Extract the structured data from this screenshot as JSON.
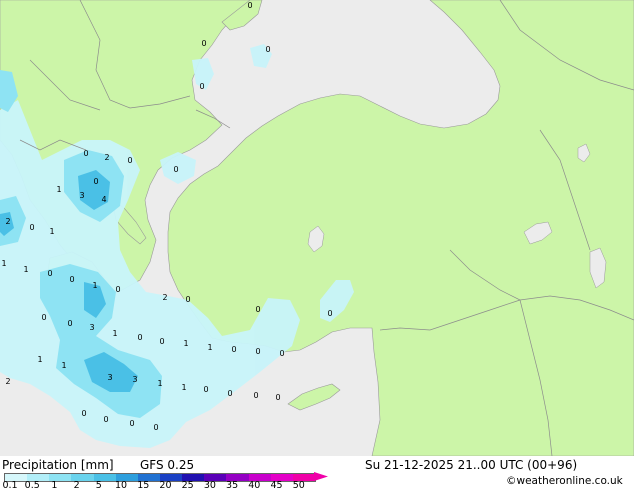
{
  "footer": {
    "title": "Precipitation [mm]",
    "model": "GFS 0.25",
    "datetime": "Su 21-12-2025 21..00 UTC (00+96)",
    "credit": "©weatheronline.co.uk"
  },
  "legend": {
    "ticks": [
      "0.1",
      "0.5",
      "1",
      "2",
      "5",
      "10",
      "15",
      "20",
      "25",
      "30",
      "35",
      "40",
      "45",
      "50"
    ],
    "colors": [
      "#d6f7fb",
      "#b2eef8",
      "#8ee3f3",
      "#6ad3ed",
      "#4ac0e6",
      "#2e9fdd",
      "#2171d1",
      "#1a40c4",
      "#2010b0",
      "#5a00b8",
      "#9400c4",
      "#c800cc",
      "#e400c8",
      "#f000a8"
    ]
  },
  "colors": {
    "sea": "#ececec",
    "land": "#ccf5a8",
    "precip_light": "#c8f4fa",
    "precip_mid": "#8ee3f3",
    "precip_heavy": "#4ac0e6",
    "border": "#8c8c8c"
  },
  "map_labels": [
    "0",
    "0",
    "0",
    "0",
    "0",
    "2",
    "0",
    "0",
    "1",
    "3",
    "4",
    "0",
    "2",
    "0",
    "1",
    "1",
    "1",
    "0",
    "0",
    "1",
    "0",
    "3",
    "2",
    "0",
    "0",
    "0",
    "3",
    "1",
    "0",
    "0",
    "1",
    "1",
    "0",
    "0",
    "0",
    "1",
    "1",
    "2",
    "3",
    "1",
    "1",
    "0",
    "0",
    "0",
    "0",
    "0",
    "0",
    "0",
    "0",
    "0",
    "0"
  ]
}
